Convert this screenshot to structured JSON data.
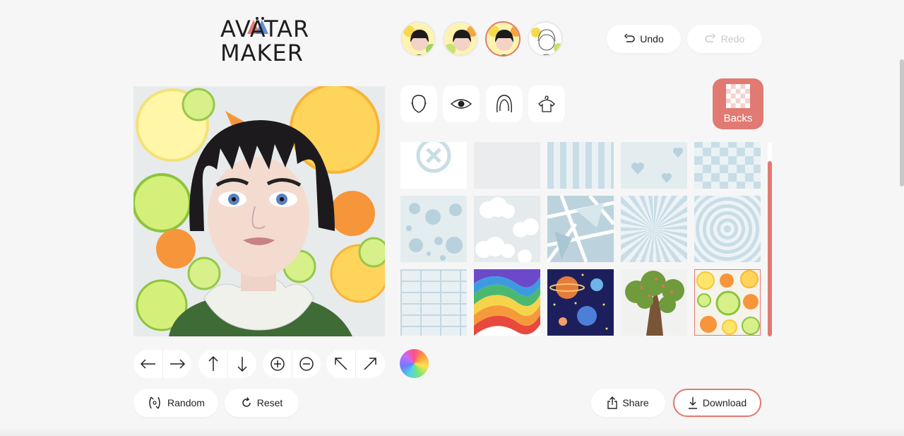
{
  "logo": {
    "line1": "AVATAR",
    "line2": "MAKER"
  },
  "history": {
    "thumbs": [
      "avatar-version-1",
      "avatar-version-2",
      "avatar-version-3",
      "avatar-version-4"
    ],
    "active_index": 2
  },
  "toolbar": {
    "undo_label": "Undo",
    "redo_label": "Redo",
    "redo_enabled": false
  },
  "categories": {
    "items": [
      "face-shape-icon",
      "eye-icon",
      "hair-icon",
      "clothes-icon"
    ],
    "active_label": "Backs"
  },
  "backgrounds": {
    "tiles": [
      "none",
      "plain",
      "stripes",
      "hearts",
      "checker",
      "dots",
      "clouds",
      "shards",
      "sunburst",
      "rings",
      "bricks",
      "rainbow",
      "space",
      "tree",
      "citrus"
    ],
    "selected": "citrus"
  },
  "controls": {
    "move": [
      "arrow-left-icon",
      "arrow-right-icon"
    ],
    "vertical": [
      "arrow-up-icon",
      "arrow-down-icon"
    ],
    "zoom": [
      "zoom-in-icon",
      "zoom-out-icon"
    ],
    "rotate": [
      "rotate-left-icon",
      "rotate-right-icon"
    ]
  },
  "actions": {
    "random_label": "Random",
    "reset_label": "Reset",
    "share_label": "Share",
    "download_label": "Download"
  },
  "colors": {
    "accent": "#e07a72",
    "background": "#f6f6f6",
    "tile_blue": "#c9dde6"
  }
}
